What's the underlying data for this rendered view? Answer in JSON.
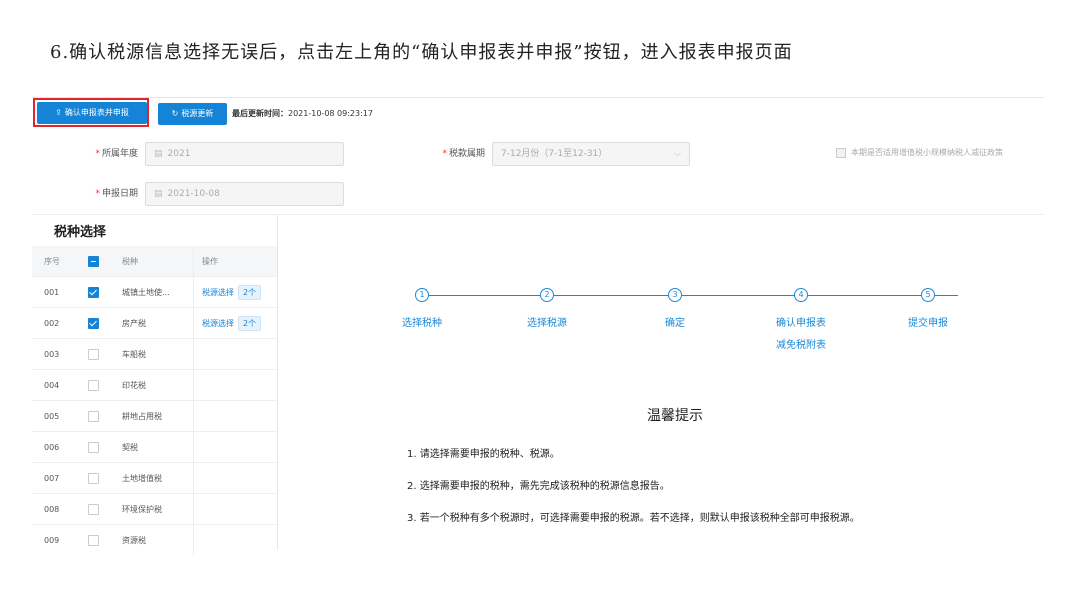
{
  "caption": "6.确认税源信息选择无误后，点击左上角的“确认申报表并申报”按钮，进入报表申报页面",
  "toolbar": {
    "confirm_label": "确认申报表并申报",
    "refresh_label": "税源更新",
    "updated_label": "最后更新时间：",
    "updated_value": "2021-10-08 09:23:17"
  },
  "form": {
    "year_label": "所属年度",
    "year_value": "2021",
    "period_label": "税款属期",
    "period_value": "7-12月份（7-1至12-31）",
    "date_label": "申报日期",
    "date_value": "2021-10-08",
    "checkbox_label": "本期是否适用增值税小规模纳税人减征政策"
  },
  "panel": {
    "title": "税种选择",
    "headers": [
      "序号",
      "",
      "税种",
      "操作"
    ],
    "rows": [
      {
        "no": "001",
        "checked": true,
        "name": "城镇土地使...",
        "action": "税源选择",
        "count": "2个"
      },
      {
        "no": "002",
        "checked": true,
        "name": "房产税",
        "action": "税源选择",
        "count": "2个"
      },
      {
        "no": "003",
        "checked": false,
        "name": "车船税",
        "action": "",
        "count": ""
      },
      {
        "no": "004",
        "checked": false,
        "name": "印花税",
        "action": "",
        "count": ""
      },
      {
        "no": "005",
        "checked": false,
        "name": "耕地占用税",
        "action": "",
        "count": ""
      },
      {
        "no": "006",
        "checked": false,
        "name": "契税",
        "action": "",
        "count": ""
      },
      {
        "no": "007",
        "checked": false,
        "name": "土地增值税",
        "action": "",
        "count": ""
      },
      {
        "no": "008",
        "checked": false,
        "name": "环境保护税",
        "action": "",
        "count": ""
      },
      {
        "no": "009",
        "checked": false,
        "name": "资源税",
        "action": "",
        "count": ""
      }
    ]
  },
  "steps": [
    {
      "num": "1",
      "label": "选择税种",
      "sub": ""
    },
    {
      "num": "2",
      "label": "选择税源",
      "sub": ""
    },
    {
      "num": "3",
      "label": "确定",
      "sub": ""
    },
    {
      "num": "4",
      "label": "确认申报表",
      "sub": "减免税附表"
    },
    {
      "num": "5",
      "label": "提交申报",
      "sub": ""
    }
  ],
  "tips": {
    "title": "温馨提示",
    "items": [
      "1. 请选择需要申报的税种、税源。",
      "2. 选择需要申报的税种，需先完成该税种的税源信息报告。",
      "3. 若一个税种有多个税源时，可选择需要申报的税源。若不选择，则默认申报该税种全部可申报税源。"
    ]
  },
  "colors": {
    "primary": "#1583d6",
    "highlight": "#e0262c"
  }
}
